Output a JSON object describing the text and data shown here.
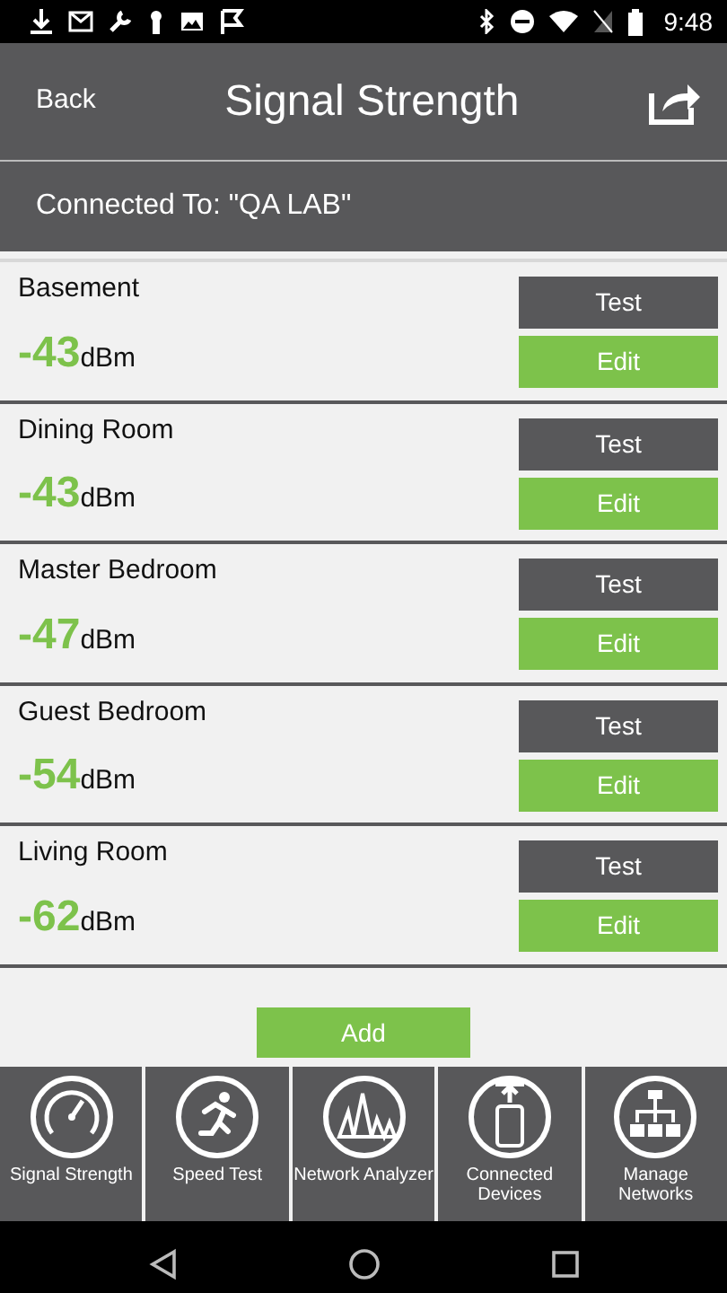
{
  "status_bar": {
    "time": "9:48"
  },
  "header": {
    "back": "Back",
    "title": "Signal Strength"
  },
  "connection": "Connected To: \"QA LAB\"",
  "locations": [
    {
      "name": "Basement",
      "value": "-43",
      "unit": "dBm",
      "test": "Test",
      "edit": "Edit"
    },
    {
      "name": "Dining Room",
      "value": "-43",
      "unit": "dBm",
      "test": "Test",
      "edit": "Edit"
    },
    {
      "name": "Master Bedroom",
      "value": "-47",
      "unit": "dBm",
      "test": "Test",
      "edit": "Edit"
    },
    {
      "name": "Guest Bedroom",
      "value": "-54",
      "unit": "dBm",
      "test": "Test",
      "edit": "Edit"
    },
    {
      "name": "Living Room",
      "value": "-62",
      "unit": "dBm",
      "test": "Test",
      "edit": "Edit"
    }
  ],
  "add_button": "Add",
  "bottom_nav": [
    {
      "kind": "gauge",
      "label": "Signal Strength"
    },
    {
      "kind": "runner",
      "label": "Speed Test"
    },
    {
      "kind": "spikes",
      "label": "Network Analyzer"
    },
    {
      "kind": "phone",
      "label": "Connected Devices"
    },
    {
      "kind": "tree",
      "label": "Manage Networks"
    }
  ]
}
